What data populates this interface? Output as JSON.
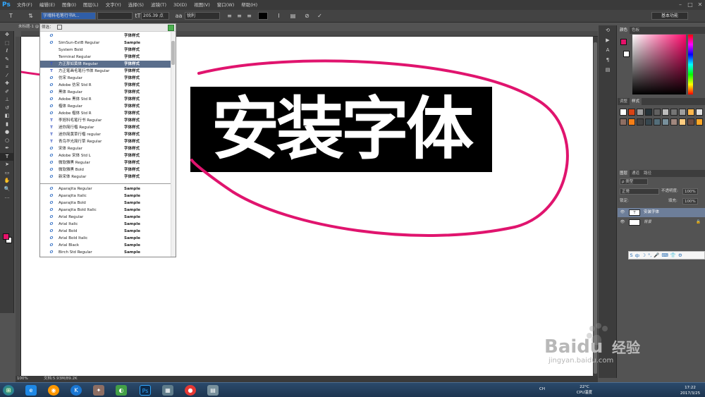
{
  "menubar": {
    "app_logo": "Ps",
    "items": [
      "文件(F)",
      "编辑(E)",
      "图像(I)",
      "图层(L)",
      "文字(Y)",
      "选择(S)",
      "滤镜(T)",
      "3D(D)",
      "视图(V)",
      "窗口(W)",
      "帮助(H)"
    ]
  },
  "options": {
    "font_family": "字魂科毛笔行书R...",
    "font_size": "205.39 点",
    "antialias": "锐利",
    "workspace": "基本功能"
  },
  "document": {
    "tab_label": "未标题-1 @",
    "text_content": "安装字体",
    "zoom": "100%",
    "doc_info": "文档:5.93M/89.2K"
  },
  "font_dropdown": {
    "filter_label": "筛选：",
    "selected_index": 3,
    "fonts_top": [
      {
        "icon": "O",
        "name": "",
        "sample": "字体样式"
      },
      {
        "icon": "O",
        "name": "SimSun-ExtB Regular",
        "sample": "Sample"
      },
      {
        "icon": "",
        "name": "System Bold",
        "sample": "字体样式"
      },
      {
        "icon": "",
        "name": "Terminal Regular",
        "sample": "字体样式"
      },
      {
        "icon": "T",
        "name": "方正那如黄体 Regular",
        "sample": "字体样式"
      },
      {
        "icon": "T",
        "name": "方正笔画毛笔行书体 Regular",
        "sample": "字体样式"
      },
      {
        "icon": "O",
        "name": "仿宋 Regular",
        "sample": "字体样式"
      },
      {
        "icon": "O",
        "name": "Adobe 仿宋 Std R",
        "sample": "字体样式"
      },
      {
        "icon": "O",
        "name": "黑体 Regular",
        "sample": "字体样式"
      },
      {
        "icon": "O",
        "name": "Adobe 黑体 Std R",
        "sample": "字体样式"
      },
      {
        "icon": "O",
        "name": "楷体 Regular",
        "sample": "字体样式"
      },
      {
        "icon": "O",
        "name": "Adobe 楷体 Std R",
        "sample": "字体样式"
      },
      {
        "icon": "T",
        "name": "李旭科毛笔行书 Regular",
        "sample": "字体样式"
      },
      {
        "icon": "T",
        "name": "迷你简行楷 Regular",
        "sample": "字体样式"
      },
      {
        "icon": "T",
        "name": "迷你简黄草行楷 regular",
        "sample": "字体样式"
      },
      {
        "icon": "T",
        "name": "青鸟华光简行草 Regular",
        "sample": "字体样式"
      },
      {
        "icon": "O",
        "name": "宋体 Regular",
        "sample": "字体样式"
      },
      {
        "icon": "O",
        "name": "Adobe 宋体 Std L",
        "sample": "字体样式"
      },
      {
        "icon": "O",
        "name": "微软雅黑 Regular",
        "sample": "字体样式"
      },
      {
        "icon": "O",
        "name": "微软雅黑 Bold",
        "sample": "字体样式"
      },
      {
        "icon": "O",
        "name": "新宋体 Regular",
        "sample": "字体样式"
      }
    ],
    "fonts_bottom": [
      {
        "icon": "O",
        "name": "Aparajita Regular",
        "sample": "Sample"
      },
      {
        "icon": "O",
        "name": "Aparajita Italic",
        "sample": "Sample"
      },
      {
        "icon": "O",
        "name": "Aparajita Bold",
        "sample": "Sample"
      },
      {
        "icon": "O",
        "name": "Aparajita Bold Italic",
        "sample": "Sample"
      },
      {
        "icon": "O",
        "name": "Arial Regular",
        "sample": "Sample"
      },
      {
        "icon": "O",
        "name": "Arial Italic",
        "sample": "Sample"
      },
      {
        "icon": "O",
        "name": "Arial Bold",
        "sample": "Sample"
      },
      {
        "icon": "O",
        "name": "Arial Bold Italic",
        "sample": "Sample"
      },
      {
        "icon": "O",
        "name": "Arial Black",
        "sample": "Sample"
      },
      {
        "icon": "O",
        "name": "Birch Std Regular",
        "sample": "Sample"
      }
    ]
  },
  "panels": {
    "color_tabs": [
      "颜色",
      "色板"
    ],
    "style_tabs": [
      "调整",
      "样式"
    ],
    "layer_tabs": [
      "图层",
      "通道",
      "路径"
    ],
    "layer_filter": "ρ 类型",
    "blend_mode": "正常",
    "opacity_label": "不透明度:",
    "opacity_value": "100%",
    "lock_label": "锁定:",
    "fill_label": "填充:",
    "fill_value": "100%",
    "layers": [
      {
        "name": "安装字体",
        "thumb": "T"
      },
      {
        "name": "背景",
        "thumb": ""
      }
    ]
  },
  "ime": {
    "items": [
      "S",
      "中",
      "☽",
      "°,",
      "🎤",
      "⌨",
      "👕",
      "⚙"
    ]
  },
  "watermark": {
    "brand": "Baidu",
    "brand_cn": "经验",
    "url": "jingyan.baidu.com"
  },
  "taskbar": {
    "lang": "CH",
    "temperature": "22°C",
    "cpu_label": "CPU温度",
    "time": "17:22",
    "date": "2017/3/25"
  },
  "colors": {
    "foreground": "#e5126a",
    "annotation": "#e0146e",
    "selected_font_row": "#5a6e8c",
    "active_layer": "#6d7e99"
  }
}
